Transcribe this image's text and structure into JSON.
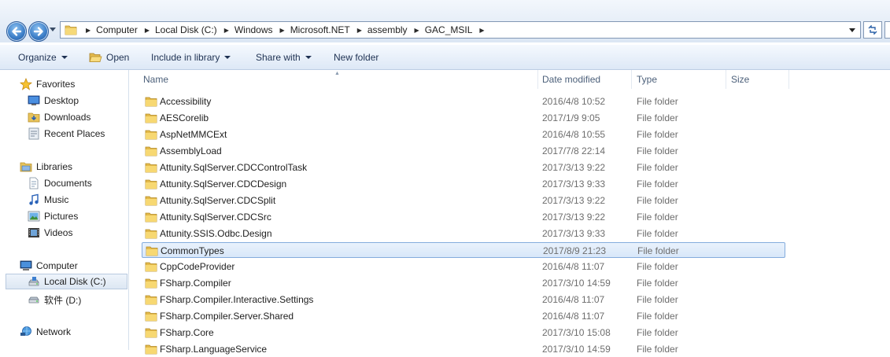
{
  "address": {
    "crumbs": [
      "Computer",
      "Local Disk (C:)",
      "Windows",
      "Microsoft.NET",
      "assembly",
      "GAC_MSIL"
    ]
  },
  "toolbar": {
    "organize": "Organize",
    "open": "Open",
    "include": "Include in library",
    "share": "Share with",
    "new_folder": "New folder"
  },
  "nav": {
    "favorites": "Favorites",
    "desktop": "Desktop",
    "downloads": "Downloads",
    "recent": "Recent Places",
    "libraries": "Libraries",
    "documents": "Documents",
    "music": "Music",
    "pictures": "Pictures",
    "videos": "Videos",
    "computer": "Computer",
    "local_disk": "Local Disk (C:)",
    "d_drive": "软件 (D:)",
    "network": "Network"
  },
  "columns": {
    "name": "Name",
    "date": "Date modified",
    "type": "Type",
    "size": "Size"
  },
  "files": [
    {
      "name": "Accessibility",
      "date": "2016/4/8 10:52",
      "type": "File folder"
    },
    {
      "name": "AESCorelib",
      "date": "2017/1/9 9:05",
      "type": "File folder"
    },
    {
      "name": "AspNetMMCExt",
      "date": "2016/4/8 10:55",
      "type": "File folder"
    },
    {
      "name": "AssemblyLoad",
      "date": "2017/7/8 22:14",
      "type": "File folder"
    },
    {
      "name": "Attunity.SqlServer.CDCControlTask",
      "date": "2017/3/13 9:22",
      "type": "File folder"
    },
    {
      "name": "Attunity.SqlServer.CDCDesign",
      "date": "2017/3/13 9:33",
      "type": "File folder"
    },
    {
      "name": "Attunity.SqlServer.CDCSplit",
      "date": "2017/3/13 9:22",
      "type": "File folder"
    },
    {
      "name": "Attunity.SqlServer.CDCSrc",
      "date": "2017/3/13 9:22",
      "type": "File folder"
    },
    {
      "name": "Attunity.SSIS.Odbc.Design",
      "date": "2017/3/13 9:33",
      "type": "File folder"
    },
    {
      "name": "CommonTypes",
      "date": "2017/8/9 21:23",
      "type": "File folder",
      "selected": true
    },
    {
      "name": "CppCodeProvider",
      "date": "2016/4/8 11:07",
      "type": "File folder"
    },
    {
      "name": "FSharp.Compiler",
      "date": "2017/3/10 14:59",
      "type": "File folder"
    },
    {
      "name": "FSharp.Compiler.Interactive.Settings",
      "date": "2016/4/8 11:07",
      "type": "File folder"
    },
    {
      "name": "FSharp.Compiler.Server.Shared",
      "date": "2016/4/8 11:07",
      "type": "File folder"
    },
    {
      "name": "FSharp.Core",
      "date": "2017/3/10 15:08",
      "type": "File folder"
    },
    {
      "name": "FSharp.LanguageService",
      "date": "2017/3/10 14:59",
      "type": "File folder"
    }
  ]
}
